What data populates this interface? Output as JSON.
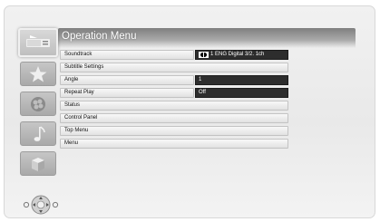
{
  "title": "Operation Menu",
  "menu": {
    "items": [
      {
        "label": "Soundtrack",
        "value": "1 ENG Digital 3/2. 1ch",
        "value_icon": "dolby-icon"
      },
      {
        "label": "Subtitle Settings"
      },
      {
        "label": "Angle",
        "value": "1"
      },
      {
        "label": "Repeat Play",
        "value": "Off"
      },
      {
        "label": "Status"
      },
      {
        "label": "Control Panel"
      },
      {
        "label": "Top Menu"
      },
      {
        "label": "Menu"
      }
    ]
  },
  "sidebar": {
    "icons": [
      "video-icon",
      "star-icon",
      "photo-icon",
      "music-icon",
      "box-icon"
    ],
    "active_index": 0
  },
  "footer": {
    "icon": "dpad-navigation-icon"
  }
}
